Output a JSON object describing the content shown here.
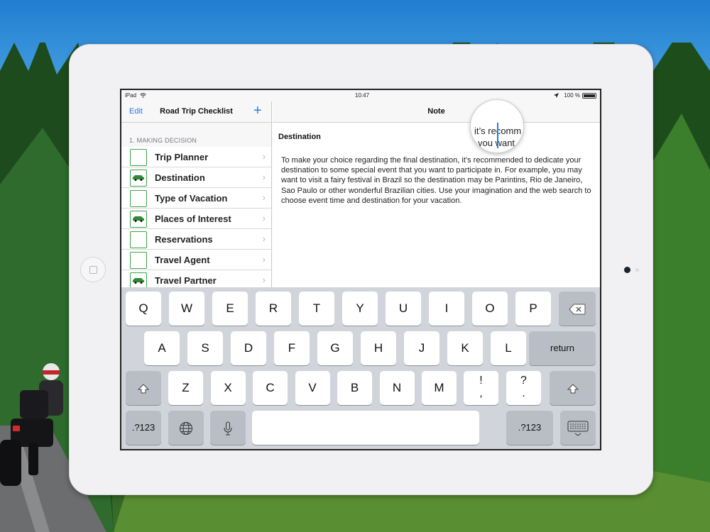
{
  "status": {
    "device": "iPad",
    "time": "10:47",
    "battery": "100 %"
  },
  "left_nav": {
    "edit": "Edit",
    "title": "Road Trip Checklist",
    "add": "+"
  },
  "section": "1. MAKING DECISION",
  "checklist": [
    {
      "label": "Trip Planner",
      "checked": false
    },
    {
      "label": "Destination",
      "checked": true
    },
    {
      "label": "Type of Vacation",
      "checked": false
    },
    {
      "label": "Places of Interest",
      "checked": true
    },
    {
      "label": "Reservations",
      "checked": false
    },
    {
      "label": "Travel Agent",
      "checked": false
    },
    {
      "label": "Travel Partner",
      "checked": true
    }
  ],
  "note": {
    "nav_title": "Note",
    "title": "Destination",
    "body": "To make your choice regarding the final destination, it’s recommended to dedicate your destination to some special event that you want to participate in. For example, you may want to visit a fairy festival in Brazil so the destination may be Parintins, Rio de Janeiro, Sao Paulo or other wonderful Brazilian cities. Use your imagination and the web search to choose event time and destination for your vacation.",
    "magnifier_line1": "it’s recomm",
    "magnifier_line2": "you want"
  },
  "keyboard": {
    "row1": [
      "Q",
      "W",
      "E",
      "R",
      "T",
      "Y",
      "U",
      "I",
      "O",
      "P"
    ],
    "row2": [
      "A",
      "S",
      "D",
      "F",
      "G",
      "H",
      "J",
      "K",
      "L"
    ],
    "row3": [
      "Z",
      "X",
      "C",
      "V",
      "B",
      "N",
      "M"
    ],
    "return": "return",
    "numbers_left": ".?123",
    "numbers_right": ".?123",
    "punct1": [
      "!",
      ","
    ],
    "punct2": [
      "?",
      "."
    ]
  },
  "colors": {
    "accent": "#2a7ae2",
    "check": "#3aa64a",
    "keyboard_bg": "#d1d4da"
  },
  "icons": {
    "backspace": "backspace-icon",
    "shift": "shift-icon",
    "globe": "globe-icon",
    "mic": "microphone-icon",
    "hide": "keyboard-hide-icon"
  }
}
